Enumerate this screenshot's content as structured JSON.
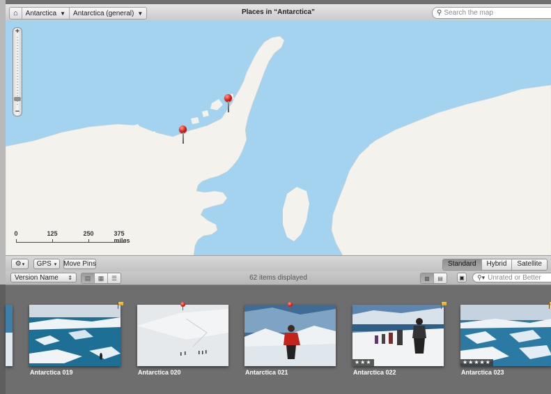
{
  "breadcrumb": {
    "home_icon": "house-icon",
    "items": [
      {
        "label": "Antarctica"
      },
      {
        "label": "Antarctica (general)"
      }
    ]
  },
  "title": "Places in “Antarctica”",
  "search": {
    "placeholder": "Search the map",
    "value": ""
  },
  "map": {
    "colors": {
      "water": "#a3d3ee",
      "land": "#f4f2ec"
    },
    "zoom_controls": {
      "zoom_in": "+",
      "zoom_out": "−",
      "level": 0.07
    },
    "scale": {
      "ticks": [
        "0",
        "125",
        "250",
        "375 miles"
      ]
    },
    "pins": [
      {
        "name": "Antarctica 021",
        "color": "#d8180f"
      },
      {
        "name": "Antarctica 020",
        "color": "#d8180f"
      }
    ]
  },
  "toolbar": {
    "gear_icon": "gear-icon",
    "gps_label": "GPS",
    "move_pins_label": "Move Pins",
    "map_types": [
      {
        "label": "Standard",
        "active": true
      },
      {
        "label": "Hybrid",
        "active": false
      },
      {
        "label": "Satellite",
        "active": false
      }
    ]
  },
  "browser_bar": {
    "sort_value": "Version Name",
    "items_displayed": "62 items displayed",
    "filter_placeholder": "Unrated or Better"
  },
  "photos": [
    {
      "label": "Antarctica 019",
      "flag": true,
      "pin": false,
      "rating": ""
    },
    {
      "label": "Antarctica 020",
      "flag": false,
      "pin": true,
      "rating": ""
    },
    {
      "label": "Antarctica 021",
      "flag": false,
      "pin": true,
      "rating": ""
    },
    {
      "label": "Antarctica 022",
      "flag": true,
      "pin": false,
      "rating": "★★★"
    },
    {
      "label": "Antarctica 023",
      "flag": true,
      "pin": false,
      "rating": "★★★★★"
    }
  ]
}
